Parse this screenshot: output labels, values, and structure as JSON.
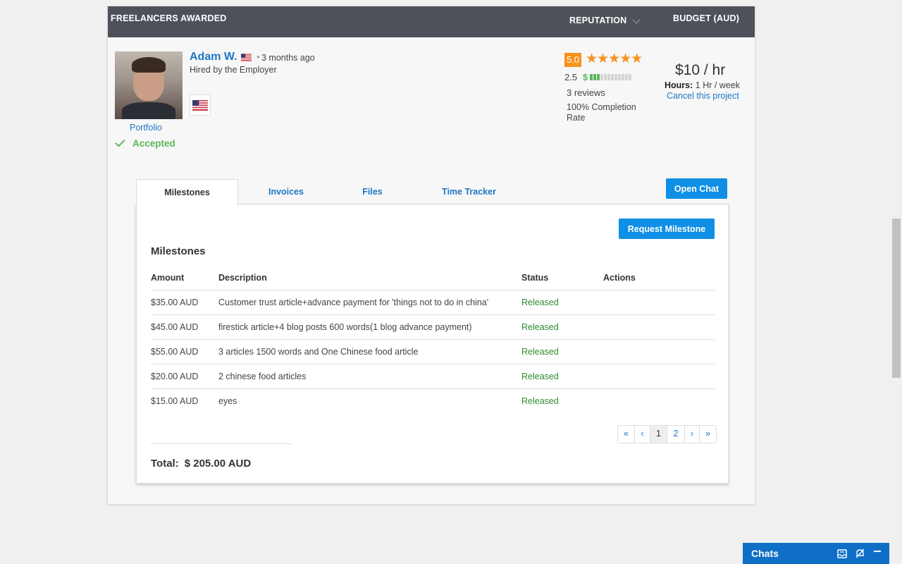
{
  "header": {
    "title": "FREELANCERS AWARDED",
    "reputation": "REPUTATION",
    "budget": "BUDGET (AUD)"
  },
  "freelancer": {
    "name": "Adam W.",
    "time_ago": "3 months ago",
    "hired_by": "Hired by the Employer",
    "portfolio_label": "Portfolio",
    "status": "Accepted",
    "rating": "5.0",
    "stars": "★★★★★",
    "spend_score": "2.5",
    "spend_symbol": "$",
    "spend_level": 0.25,
    "reviews": "3 reviews",
    "completion": "100% Completion Rate",
    "rate": "$10 / hr",
    "hours_label": "Hours:",
    "hours_value": "1 Hr / week",
    "cancel_label": "Cancel this project"
  },
  "tabs": [
    {
      "label": "Milestones",
      "active": true
    },
    {
      "label": "Invoices"
    },
    {
      "label": "Files"
    },
    {
      "label": "Time Tracker"
    }
  ],
  "open_chat_label": "Open Chat",
  "milestones": {
    "request_label": "Request Milestone",
    "title": "Milestones",
    "columns": [
      "Amount",
      "Description",
      "Status",
      "Actions"
    ],
    "rows": [
      {
        "amount": "$35.00 AUD",
        "description": "Customer trust article+advance payment for 'things not to do in china'",
        "status": "Released",
        "actions": ""
      },
      {
        "amount": "$45.00 AUD",
        "description": "firestick article+4 blog posts 600 words(1 blog advance payment)",
        "status": "Released",
        "actions": ""
      },
      {
        "amount": "$55.00 AUD",
        "description": "3 articles 1500 words and One Chinese food article",
        "status": "Released",
        "actions": ""
      },
      {
        "amount": "$20.00 AUD",
        "description": "2 chinese food articles",
        "status": "Released",
        "actions": ""
      },
      {
        "amount": "$15.00 AUD",
        "description": "eyes",
        "status": "Released",
        "actions": ""
      }
    ],
    "pagination": {
      "first": "«",
      "prev": "‹",
      "pages": [
        "1",
        "2"
      ],
      "current": "1",
      "next": "›",
      "last": "»"
    },
    "total_label": "Total:",
    "total_value": "$ 205.00 AUD"
  },
  "chat_bar": {
    "label": "Chats"
  },
  "colors": {
    "accent": "#1f76c5",
    "button": "#0f8fe5",
    "success": "#5cb85c",
    "rating": "#f6921e",
    "header": "#4d525a"
  }
}
